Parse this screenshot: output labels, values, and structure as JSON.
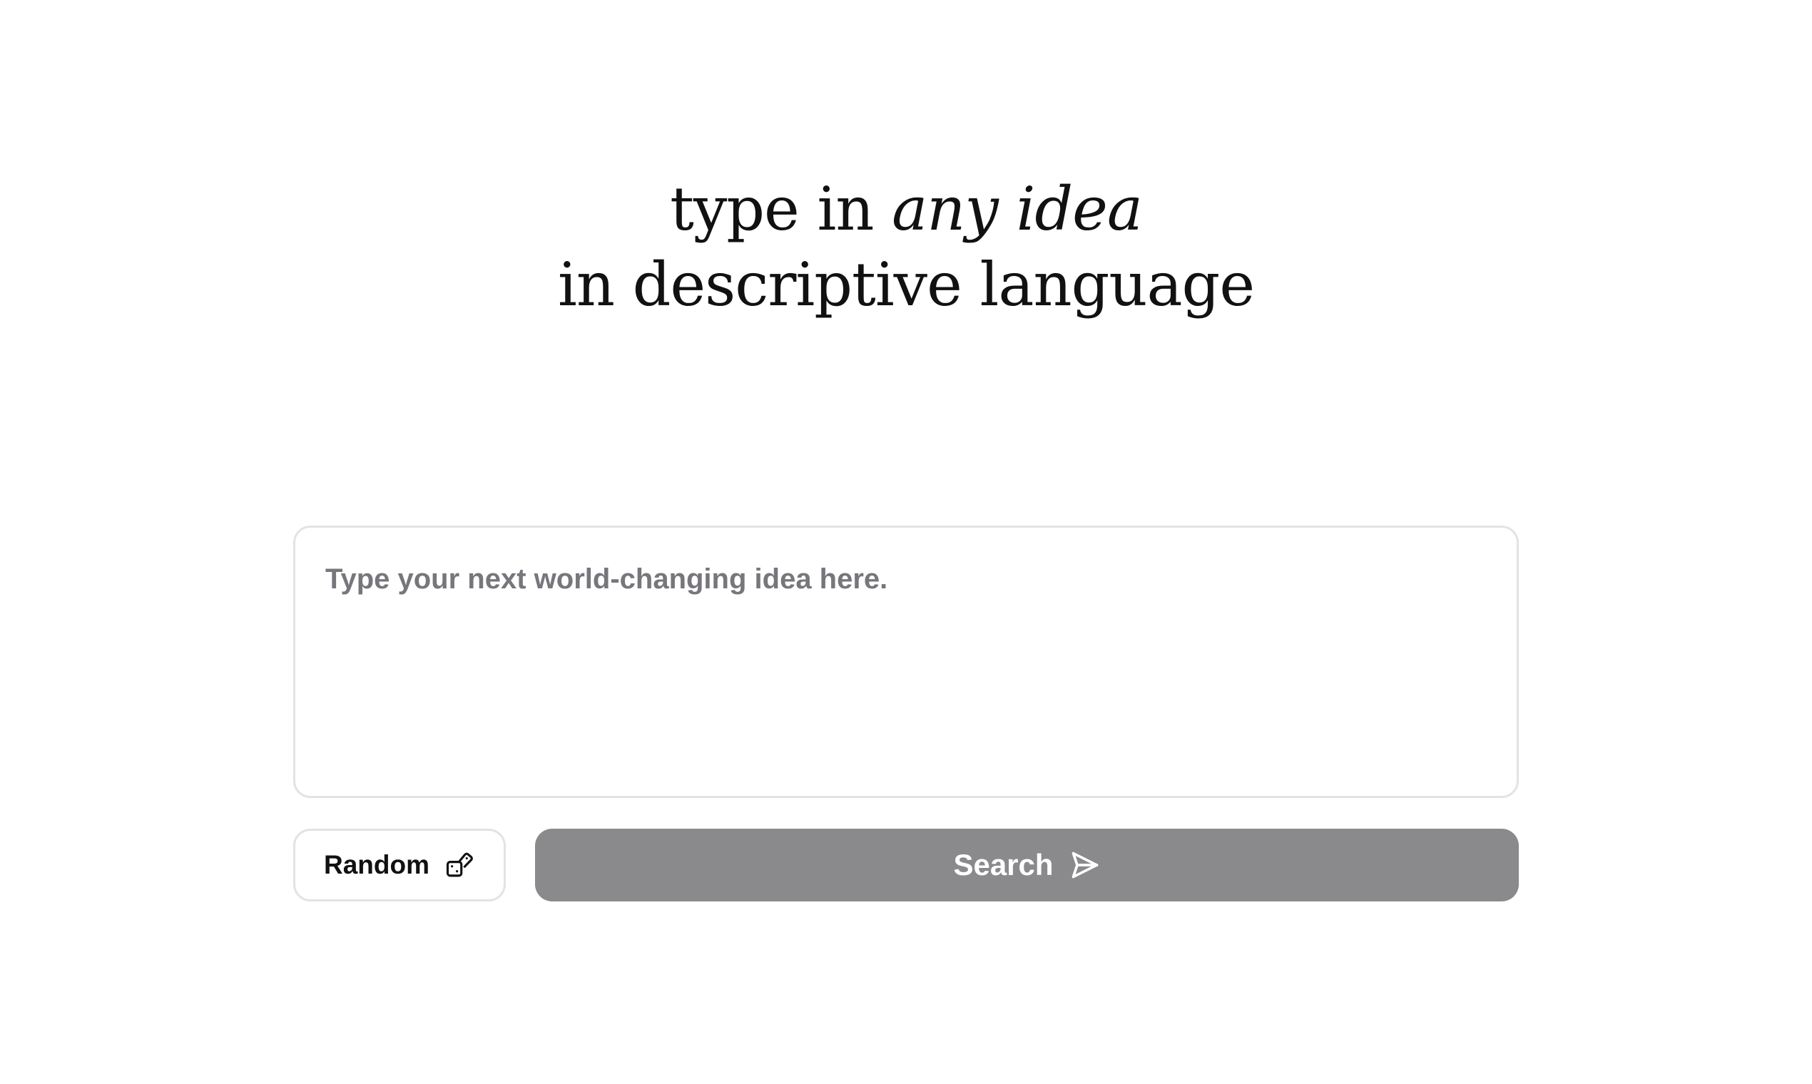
{
  "hero": {
    "line1_plain": "type in ",
    "line1_emphasis": "any idea",
    "line2": "in descriptive language"
  },
  "idea_input": {
    "placeholder": "Type your next world-changing idea here.",
    "value": ""
  },
  "actions": {
    "random_label": "Random",
    "random_icon": "dice-icon",
    "search_label": "Search",
    "search_icon": "send-icon"
  },
  "colors": {
    "search_button_bg": "#8a8a8c",
    "border": "#e3e3e6",
    "placeholder": "#77767c"
  }
}
